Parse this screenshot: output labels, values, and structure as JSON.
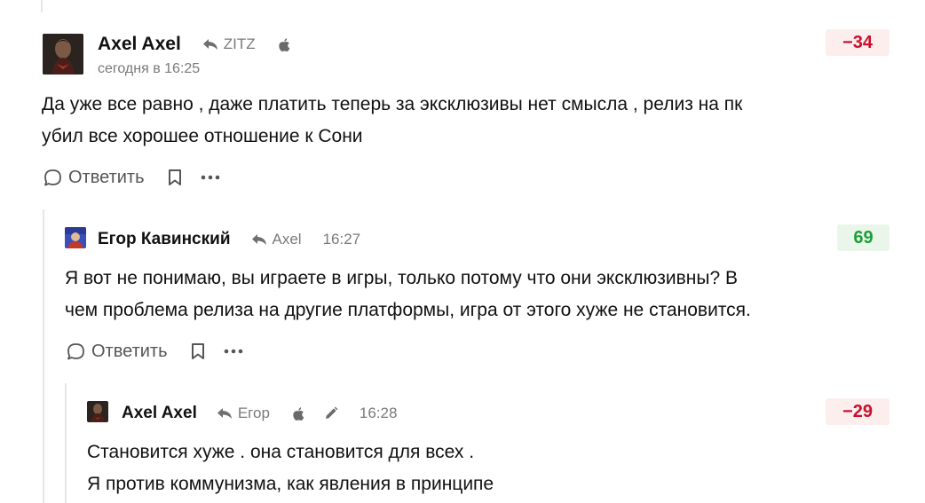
{
  "comments": [
    {
      "author": "Axel Axel",
      "reply_to": "ZITZ",
      "time": "сегодня в 16:25",
      "rating": "−34",
      "text_lines": [
        "Да уже все равно , даже платить теперь за эксклюзивы нет смысла , релиз на пк",
        "убил все хорошее отношение к Сони"
      ],
      "reply_label": "Ответить"
    },
    {
      "author": "Егор Кавинский",
      "reply_to": "Axel",
      "time": "16:27",
      "rating": "69",
      "text_lines": [
        "Я вот не понимаю, вы играете в игры, только потому что они эксклюзивны? В",
        "чем проблема релиза на другие платформы, игра от этого хуже не становится."
      ],
      "reply_label": "Ответить"
    },
    {
      "author": "Axel Axel",
      "reply_to": "Егор",
      "time": "16:28",
      "rating": "−29",
      "text_lines": [
        "Становится хуже . она становится для всех .",
        "Я против коммунизма, как явления в принципе"
      ]
    }
  ],
  "icons": {
    "reply_arrow": "reply-arrow-icon",
    "apple": "apple-icon",
    "pencil": "pencil-icon",
    "comment": "comment-bubble-icon",
    "bookmark": "bookmark-icon",
    "more": "more-dots-icon"
  },
  "colors": {
    "negative": "#c8102e",
    "positive": "#1e9e3a",
    "thread_line": "#e6e6e6"
  }
}
